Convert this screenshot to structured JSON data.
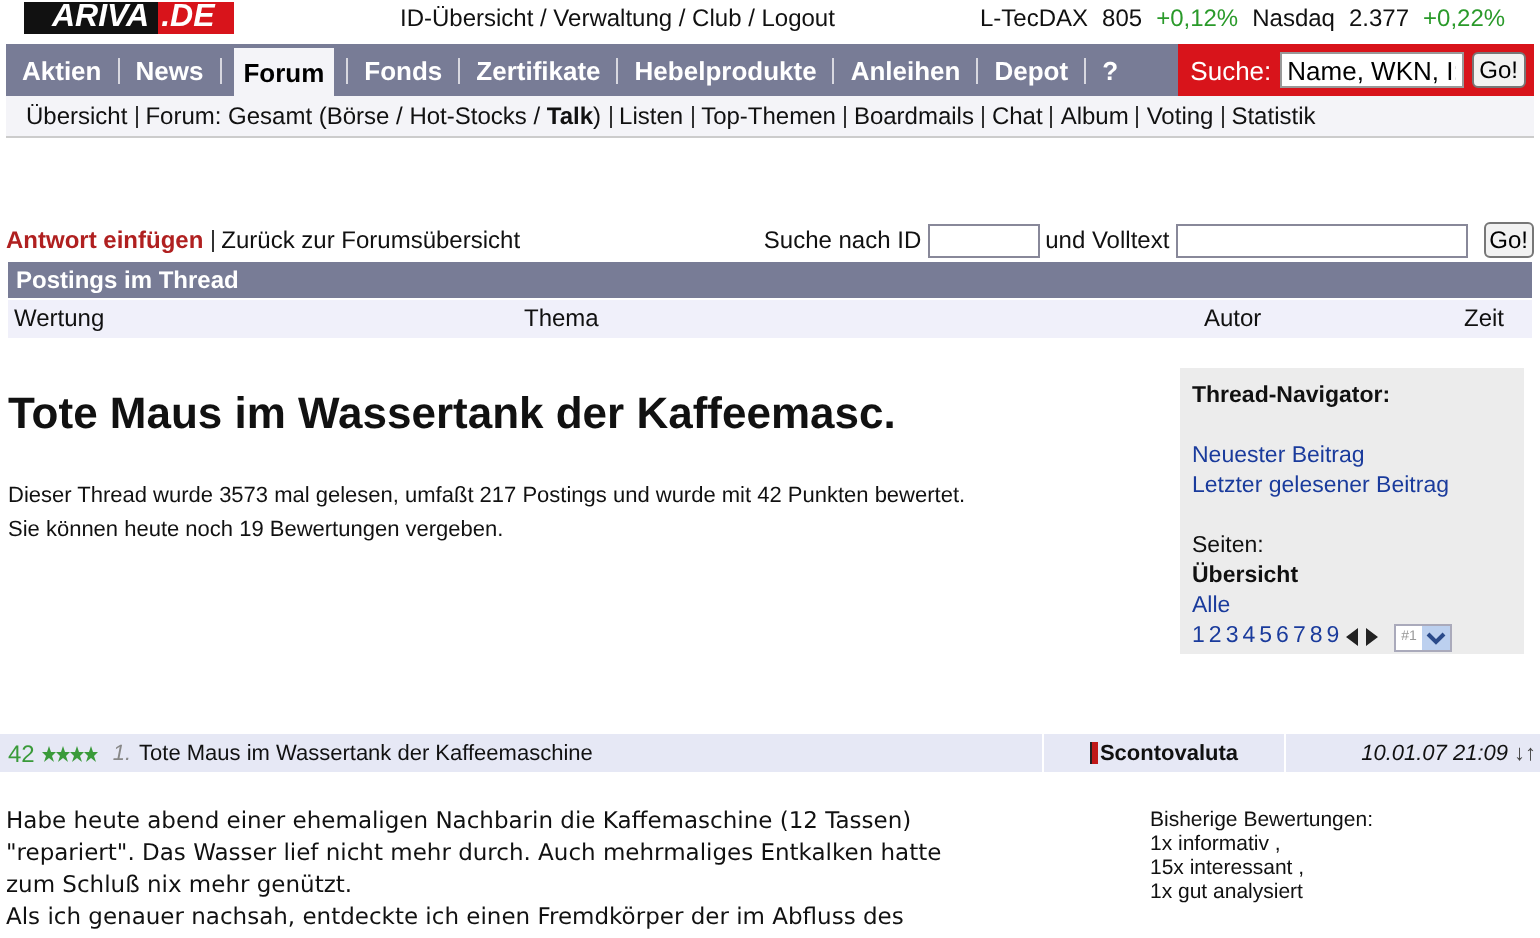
{
  "logo": {
    "text": "ARIVA",
    "accent": ".DE"
  },
  "top_links": [
    "ID-Übersicht / Verwaltung / Club / Logout"
  ],
  "ticker": [
    {
      "name": "L-TecDAX",
      "value": "805",
      "change": "+0,12%"
    },
    {
      "name": "Nasdaq",
      "value": "2.377",
      "change": "+0,22%"
    }
  ],
  "tabs": [
    {
      "label": "Aktien",
      "selected": false
    },
    {
      "label": "News",
      "selected": false
    },
    {
      "label": "Forum",
      "selected": true
    },
    {
      "label": "Fonds",
      "selected": false
    },
    {
      "label": "Zertifikate",
      "selected": false
    },
    {
      "label": "Hebelprodukte",
      "selected": false
    },
    {
      "label": "Anleihen",
      "selected": false
    },
    {
      "label": "Depot",
      "selected": false
    },
    {
      "label": "?",
      "selected": false
    }
  ],
  "search": {
    "label": "Suche:",
    "value": "Name, WKN, I:",
    "button": "Go!"
  },
  "subnav": [
    "Übersicht",
    "Forum: Gesamt (Börse / Hot-Stocks / **Talk**)",
    "Listen",
    "Top-Themen",
    "Boardmails",
    "Chat",
    "Album",
    "Voting",
    "Statistik"
  ],
  "actions": {
    "reply": "Antwort einfügen",
    "back": "Zurück zur Forumsübersicht",
    "id_label": "Suche nach ID",
    "text_label": "und Volltext",
    "button": "Go!"
  },
  "section_title": "Postings im Thread",
  "columns": [
    "Wertung",
    "Thema",
    "Autor",
    "Zeit"
  ],
  "thread": {
    "title": "Tote Maus im Wassertank der Kaffeemasc.",
    "info": [
      "Dieser Thread wurde 3573 mal gelesen, umfaßt 217 Postings und wurde mit 42 Punkten bewertet.",
      "Sie können heute noch 19 Bewertungen vergeben."
    ]
  },
  "navigator": {
    "title": "Thread-Navigator:",
    "links": [
      "Neuester Beitrag",
      "Letzter gelesener Beitrag"
    ],
    "pages_label": "Seiten:",
    "overview": "Übersicht",
    "all": "Alle",
    "pages": [
      "1",
      "2",
      "3",
      "4",
      "5",
      "6",
      "7",
      "8",
      "9"
    ],
    "select": "#1"
  },
  "post": {
    "score": "42",
    "stars": 4,
    "number": "1.",
    "title": "Tote Maus im Wassertank der Kaffeemaschine",
    "author": "Scontovaluta",
    "time": "10.01.07 21:09",
    "arrows": "↓↑",
    "body": [
      "Habe heute abend einer ehemaligen Nachbarin die Kaffemaschine (12 Tassen)",
      "\"repariert\". Das Wasser lief nicht mehr durch. Auch mehrmaliges Entkalken hatte",
      "zum Schluß nix mehr genützt.",
      "Als ich genauer nachsah, entdeckte ich einen Fremdkörper der im Abfluss des"
    ],
    "ratings": [
      "Bisherige Bewertungen:",
      "1x informativ ,",
      "15x interessant ,",
      "1x gut analysiert"
    ]
  }
}
